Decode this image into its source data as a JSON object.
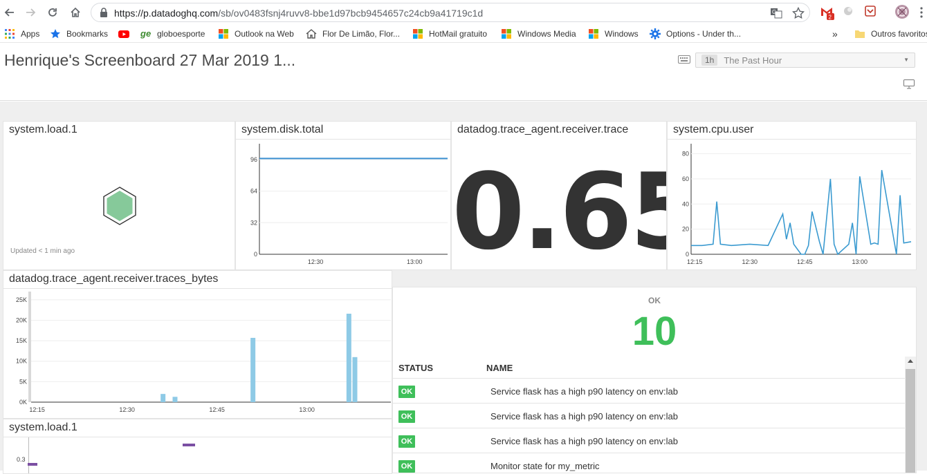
{
  "browser": {
    "url_host": "https://p.datadoghq.com",
    "url_path": "/sb/ov0483fsnj4ruvv8-bbe1d97bcb9454657c24cb9a41719c1d",
    "gmail_badge": "2",
    "bookmarks": [
      {
        "label": "Apps",
        "icon": "apps-grid-icon"
      },
      {
        "label": "Bookmarks",
        "icon": "star-icon"
      },
      {
        "label": "",
        "icon": "youtube-icon"
      },
      {
        "label": "globoesporte",
        "icon": "ge-icon",
        "prefix": "ge"
      },
      {
        "label": "Outlook na Web",
        "icon": "windows-icon"
      },
      {
        "label": "Flor De Limão, Flor...",
        "icon": "home-icon"
      },
      {
        "label": "HotMail gratuito",
        "icon": "windows-icon"
      },
      {
        "label": "Windows Media",
        "icon": "windows-icon"
      },
      {
        "label": "Windows",
        "icon": "windows-icon"
      },
      {
        "label": "Options - Under th...",
        "icon": "gear-icon"
      }
    ],
    "overflow_label": "»",
    "other_bookmarks": "Outros favoritos"
  },
  "header": {
    "title": "Henrique's Screenboard 27 Mar 2019 1...",
    "timeframe_badge": "1h",
    "timeframe_label": "The Past Hour"
  },
  "widgets": {
    "hostmap": {
      "title": "system.load.1",
      "updated": "Updated < 1 min ago",
      "hex_color": "#86c99a"
    },
    "disk": {
      "title": "system.disk.total",
      "yticks": [
        "96",
        "64",
        "32",
        "0"
      ],
      "xticks": [
        "12:30",
        "13:00"
      ]
    },
    "trace_value": {
      "title": "datadog.trace_agent.receiver.trace",
      "value": "0.65"
    },
    "cpu": {
      "title": "system.cpu.user",
      "yticks": [
        "80",
        "60",
        "40",
        "20",
        "0"
      ],
      "xticks": [
        "12:15",
        "12:30",
        "12:45",
        "13:00"
      ]
    },
    "traces_bytes": {
      "title": "datadog.trace_agent.receiver.traces_bytes",
      "yticks": [
        "25K",
        "20K",
        "15K",
        "10K",
        "5K",
        "0K"
      ],
      "xticks": [
        "12:15",
        "12:30",
        "12:45",
        "13:00"
      ]
    },
    "load2": {
      "title": "system.load.1",
      "yticks": [
        "0.3"
      ]
    },
    "monitors": {
      "ok_label": "OK",
      "ok_count": "10",
      "col_status": "STATUS",
      "col_name": "NAME",
      "rows": [
        {
          "status": "OK",
          "name": "Service flask has a high p90 latency on env:lab"
        },
        {
          "status": "OK",
          "name": "Service flask has a high p90 latency on env:lab"
        },
        {
          "status": "OK",
          "name": "Service flask has a high p90 latency on env:lab"
        },
        {
          "status": "OK",
          "name": "Monitor state for my_metric"
        }
      ]
    }
  },
  "chart_data": [
    {
      "type": "line",
      "title": "system.disk.total",
      "x": [
        "12:13",
        "12:20",
        "12:30",
        "12:40",
        "12:50",
        "13:00",
        "13:10"
      ],
      "series": [
        {
          "values": [
            97,
            97,
            97,
            97,
            97,
            97,
            97
          ]
        }
      ],
      "ylim": [
        0,
        112
      ],
      "color": "#3a8fd0"
    },
    {
      "type": "line",
      "title": "system.cpu.user",
      "x": [
        "12:14",
        "12:17",
        "12:20",
        "12:21",
        "12:22",
        "12:25",
        "12:30",
        "12:35",
        "12:39",
        "12:40",
        "12:41",
        "12:42",
        "12:44",
        "12:45",
        "12:46",
        "12:47",
        "12:49",
        "12:50",
        "12:52",
        "12:53",
        "12:54",
        "12:57",
        "12:58",
        "12:59",
        "13:00",
        "13:03",
        "13:04",
        "13:05",
        "13:06",
        "13:10",
        "13:11",
        "13:12",
        "13:14"
      ],
      "series": [
        {
          "values": [
            7,
            7,
            8,
            42,
            8,
            7,
            8,
            7,
            32,
            12,
            25,
            8,
            0,
            0,
            7,
            34,
            10,
            0,
            60,
            8,
            0,
            8,
            25,
            0,
            62,
            8,
            9,
            8,
            67,
            0,
            47,
            9,
            10
          ]
        }
      ],
      "ylim": [
        0,
        88
      ],
      "color": "#3a9ad0"
    },
    {
      "type": "bar",
      "title": "datadog.trace_agent.receiver.traces_bytes",
      "x": [
        "12:36",
        "12:38",
        "12:51",
        "13:07",
        "13:08"
      ],
      "series": [
        {
          "values": [
            2000,
            1300,
            15700,
            21600,
            11000
          ]
        }
      ],
      "ylim": [
        0,
        27000
      ],
      "color": "#8ecae6"
    }
  ]
}
